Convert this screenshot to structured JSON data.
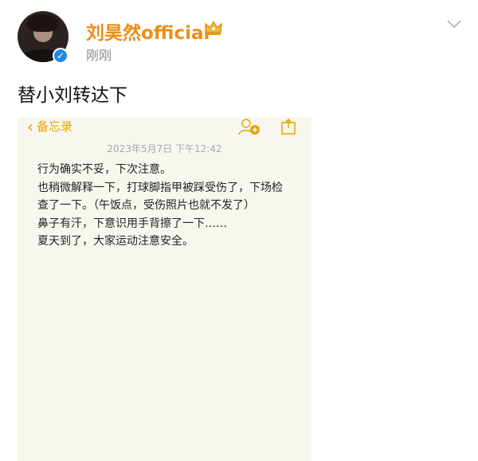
{
  "header": {
    "username": "刘昊然official",
    "timestamp": "刚刚",
    "verified_icon": "verified-check-icon",
    "crown_icon": "crown-icon",
    "menu_icon": "chevron-down-icon"
  },
  "post": {
    "text": "替小刘转达下"
  },
  "note": {
    "back_label": "备忘录",
    "date": "2023年5月7日 下午12:42",
    "lines": [
      "行为确实不妥，下次注意。",
      "也稍微解释一下，打球脚指甲被踩受伤了，下场检查了一下。（午饭点，受伤照片也就不发了）",
      "鼻子有汗，下意识用手背擦了一下……",
      "夏天到了，大家运动注意安全。"
    ]
  },
  "colors": {
    "username": "#f08c16",
    "note_accent": "#e9a100",
    "note_background": "#f8f7ef",
    "verified": "#1e88e5"
  }
}
